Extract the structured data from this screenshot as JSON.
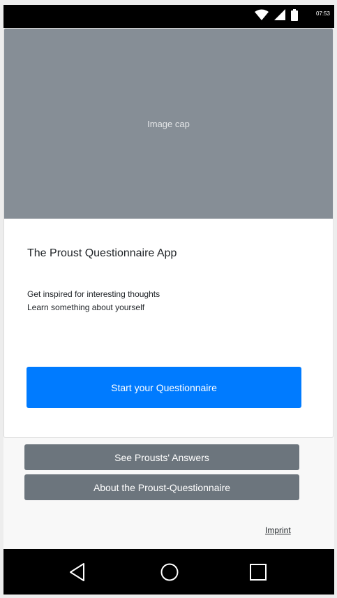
{
  "status_bar": {
    "time": "07:53",
    "icons": [
      "wifi-icon",
      "signal-icon",
      "battery-icon"
    ]
  },
  "card": {
    "image_cap": "Image cap",
    "title": "The Proust Questionnaire App",
    "lines": [
      "Get inspired for interesting thoughts",
      "Learn something about yourself"
    ],
    "primary_button": "Start your Questionnaire"
  },
  "buttons": {
    "answers": "See Prousts' Answers",
    "about": "About the Proust-Questionnaire"
  },
  "footer": {
    "imprint": "Imprint"
  },
  "nav_bar": {
    "icons": [
      "back-icon",
      "home-icon",
      "recent-apps-icon"
    ]
  },
  "colors": {
    "primary": "#007bff",
    "secondary": "#6c757d",
    "image_placeholder": "#868e96"
  }
}
